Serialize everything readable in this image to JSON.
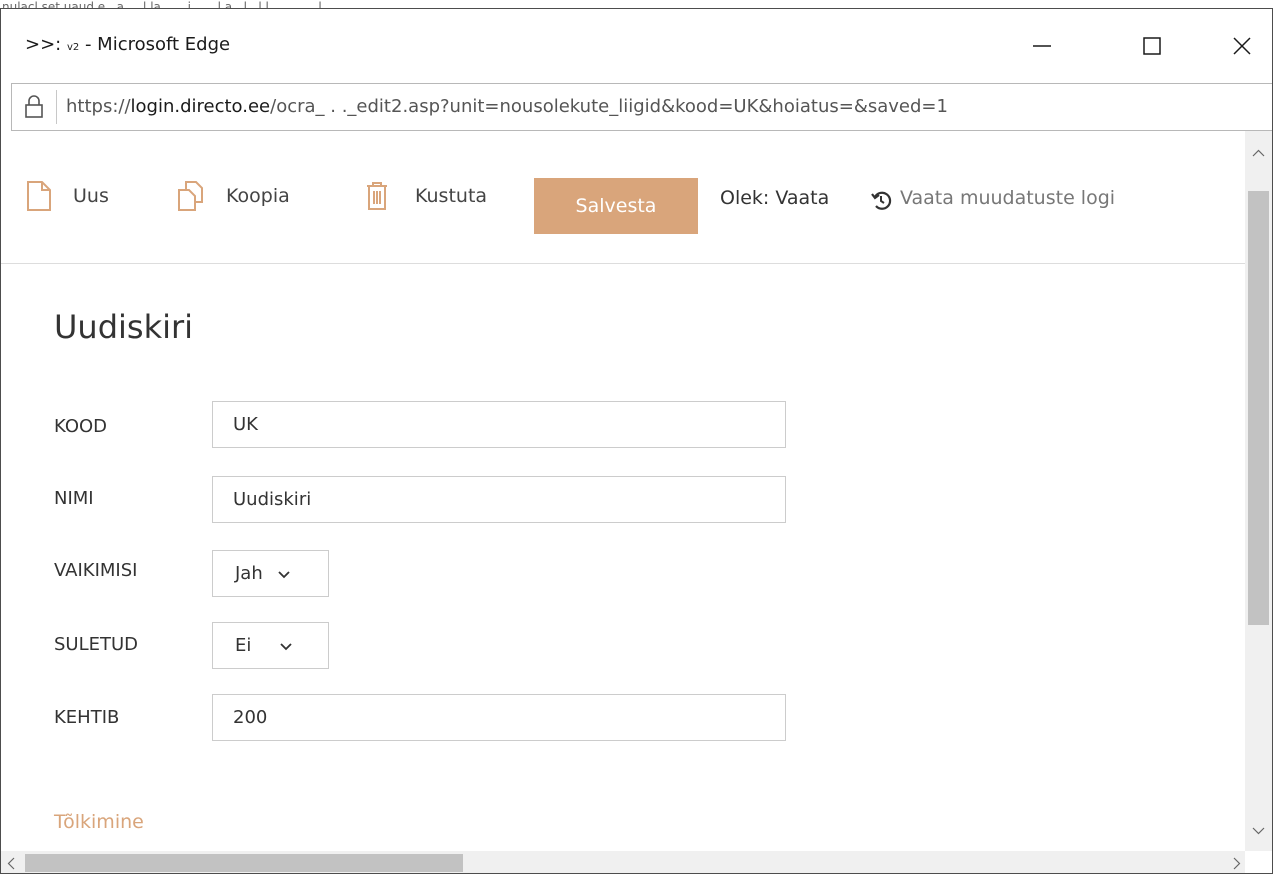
{
  "caption": "nulacl set uaud e ..a.,. .l.la. .... i., .. .l.a...l...l.l.... ........l..",
  "window": {
    "title_prefix": ">>: ",
    "title_v2": "v2",
    "title_suffix": " - Microsoft Edge"
  },
  "address": {
    "scheme": "https://",
    "host": "login.directo.ee",
    "path": "/ocra_        . ._edit2.asp?unit=nousolekute_liigid&kood=UK&hoiatus=&saved=1"
  },
  "toolbar": {
    "new_label": "Uus",
    "copy_label": "Koopia",
    "delete_label": "Kustuta",
    "save_label": "Salvesta",
    "state_label": "Olek: Vaata",
    "log_label": "Vaata muudatuste logi"
  },
  "form": {
    "title": "Uudiskiri",
    "kood": {
      "label": "KOOD",
      "value": "UK"
    },
    "nimi": {
      "label": "NIMI",
      "value": "Uudiskiri"
    },
    "vaikimisi": {
      "label": "VAIKIMISI",
      "value": "Jah"
    },
    "suletud": {
      "label": "SULETUD",
      "value": "Ei"
    },
    "kehtib": {
      "label": "KEHTIB",
      "value": "200"
    }
  },
  "section": {
    "translation_label": "Tõlkimine"
  },
  "colors": {
    "accent": "#d9a57b",
    "border": "#cccccc",
    "text": "#333333"
  }
}
